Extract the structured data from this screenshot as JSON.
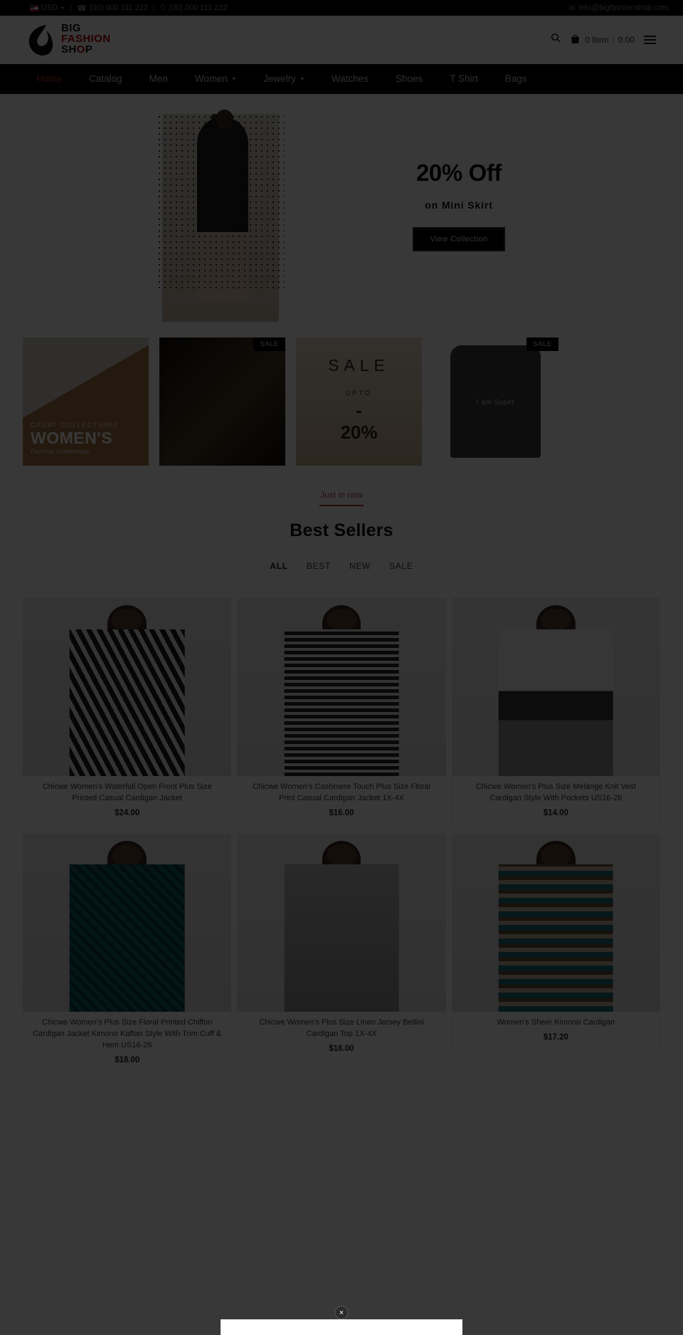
{
  "topbar": {
    "currency": "USD",
    "phone1": "(00) 000 111 222",
    "phone2": "(00) 000 111 222",
    "email": "info@bigfashionshop.com",
    "sep": "|"
  },
  "header": {
    "logo_line1": "BIG",
    "logo_line2": "FASHION",
    "logo_line3a": "SH",
    "logo_line3b": "O",
    "logo_line3c": "P",
    "cart_items": "0 Item",
    "cart_total": "0.00",
    "cart_sep": "|"
  },
  "nav": {
    "items": [
      {
        "label": "Home",
        "active": true,
        "caret": false
      },
      {
        "label": "Catalog",
        "active": false,
        "caret": false
      },
      {
        "label": "Men",
        "active": false,
        "caret": false
      },
      {
        "label": "Women",
        "active": false,
        "caret": true
      },
      {
        "label": "Jewelry",
        "active": false,
        "caret": true
      },
      {
        "label": "Watches",
        "active": false,
        "caret": false
      },
      {
        "label": "Shoes",
        "active": false,
        "caret": false
      },
      {
        "label": "T Shirt",
        "active": false,
        "caret": false
      },
      {
        "label": "Bags",
        "active": false,
        "caret": false
      }
    ]
  },
  "hero": {
    "headline": "20% Off",
    "subline": "on Mini Skirt",
    "cta": "View Collection"
  },
  "categories": [
    {
      "eyebrow": "GREAT COLLECTIONS",
      "title": "WOMEN'S",
      "sub": "Fashion Underwear",
      "sale": ""
    },
    {
      "eyebrow": "",
      "title": "",
      "sub": "",
      "sale": "SALE"
    },
    {
      "eyebrow": "",
      "title": "",
      "sub": "",
      "sale": "",
      "w1": "SALE",
      "w2": "UPTO",
      "w3": "-",
      "w4": "20%"
    },
    {
      "eyebrow": "",
      "title": "",
      "sub": "I am Super",
      "sale": "SALE"
    }
  ],
  "section": {
    "eyebrow": "Just in now",
    "title": "Best Sellers",
    "filters": [
      {
        "label": "ALL",
        "active": true
      },
      {
        "label": "BEST",
        "active": false
      },
      {
        "label": "NEW",
        "active": false
      },
      {
        "label": "SALE",
        "active": false
      }
    ]
  },
  "products": [
    {
      "title": "Chicwe Women's Waterfall Open Front Plus Size Printed Casual Cardigan Jacket",
      "price": "$24.00"
    },
    {
      "title": "Chicwe Women's Cashmere Touch Plus Size Floral Print Casual Cardigan Jacket 1X-4X",
      "price": "$16.00"
    },
    {
      "title": "Chicwe Women's Plus Size Melange Knit Vest Cardigan Style With Pockets US16-26",
      "price": "$14.00"
    },
    {
      "title": "Chicwe Women's Plus Size Floral Printed Chiffon Cardigan Jacket Kimono Kaftan Style With Trim Cuff & Hem US16-26",
      "price": "$18.00"
    },
    {
      "title": "Chicwe Women's Plus Size Linen Jersey Bellini Cardigan Top 1X-4X",
      "price": "$16.00"
    },
    {
      "title": "Women's Sheer Kimono Cardigan",
      "price": "$17.20"
    }
  ],
  "modal": {
    "close_label": "×"
  },
  "colors": {
    "accent": "#b30000",
    "nav_bg": "#000000",
    "active_nav": "#c0392b"
  }
}
